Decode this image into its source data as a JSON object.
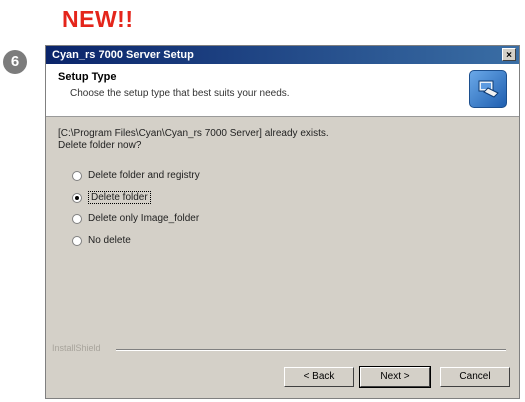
{
  "badge": "NEW!!",
  "step_number": "6",
  "window": {
    "title": "Cyan_rs 7000 Server Setup",
    "close_label": "×"
  },
  "header": {
    "title": "Setup Type",
    "description": "Choose the setup type that best suits your needs."
  },
  "message": {
    "line1": "[C:\\Program Files\\Cyan\\Cyan_rs 7000 Server] already exists.",
    "line2": "Delete folder now?"
  },
  "options": [
    {
      "label": "Delete folder and registry",
      "checked": false
    },
    {
      "label": "Delete folder",
      "checked": true
    },
    {
      "label": "Delete only Image_folder",
      "checked": false
    },
    {
      "label": "No delete",
      "checked": false
    }
  ],
  "footer": {
    "brand": "InstallShield"
  },
  "buttons": {
    "back": "< Back",
    "next": "Next >",
    "cancel": "Cancel"
  },
  "icons": {
    "setup": "setup-icon",
    "close": "close-icon"
  }
}
